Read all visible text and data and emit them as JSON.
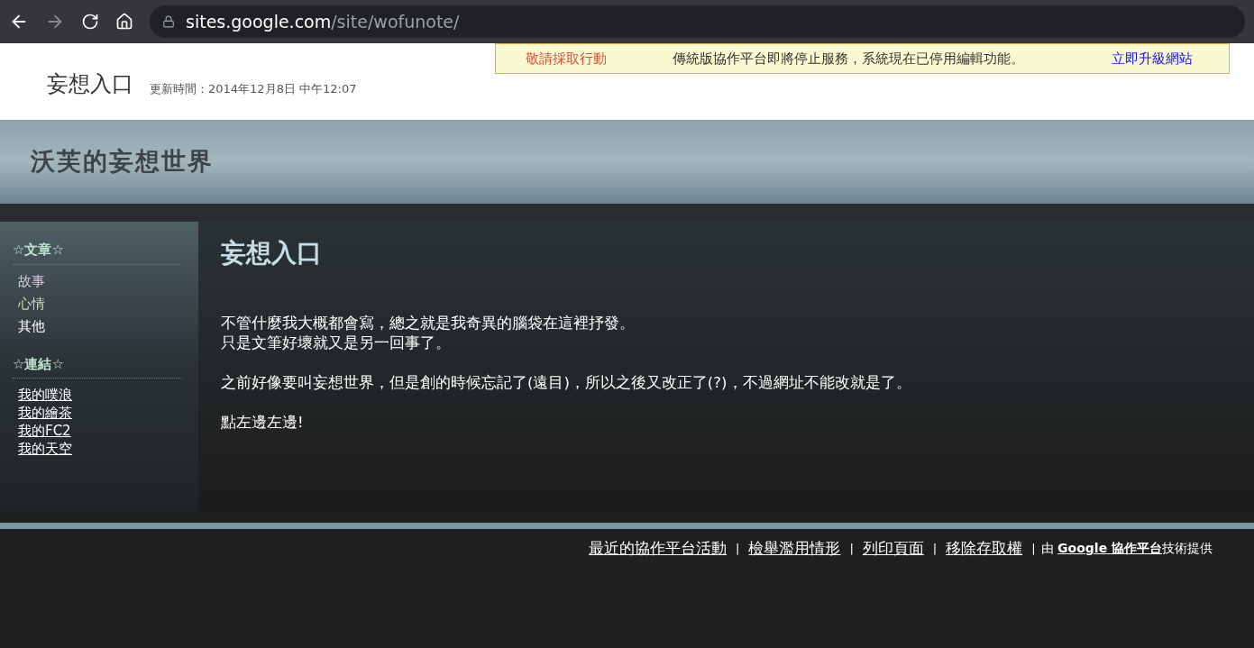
{
  "browser": {
    "url_host": "sites.google.com",
    "url_path": "/site/wofunote/"
  },
  "notice": {
    "action": "敬請採取行動",
    "message": "傳統版協作平台即將停止服務，系統現在已停用編輯功能。",
    "link": "立即升級網站"
  },
  "page_header": {
    "title": "妄想入口",
    "updated": "更新時間：2014年12月8日 中午12:07"
  },
  "site_title": "沃芙的妄想世界",
  "sidebar": {
    "sections": [
      {
        "heading": "☆文章☆",
        "kind": "nav",
        "items": [
          {
            "label": "故事",
            "color": "#d6c9e0"
          },
          {
            "label": "心情",
            "color": "#cfdcb4"
          },
          {
            "label": "其他",
            "color": "#ffffff"
          }
        ]
      },
      {
        "heading": "☆連結☆",
        "kind": "links",
        "items": [
          {
            "label": "我的噗浪",
            "color": "#ffffff"
          },
          {
            "label": "我的繪茶",
            "color": "#ffffff"
          },
          {
            "label": "我的FC2",
            "color": "#ffffff"
          },
          {
            "label": "我的天空",
            "color": "#ffffff"
          }
        ]
      }
    ]
  },
  "content": {
    "title": "妄想入口",
    "paragraphs": [
      [
        "不管什麼我大概都會寫，總之就是我奇異的腦袋在這裡抒發。",
        "只是文筆好壞就又是另一回事了。"
      ],
      [
        "之前好像要叫妄想世界，但是創的時候忘記了(遠目)，所以之後又改正了(?)，不過網址不能改就是了。"
      ],
      [
        "點左邊左邊!"
      ]
    ]
  },
  "footer": {
    "links": [
      "最近的協作平台活動",
      "檢舉濫用情形",
      "列印頁面",
      "移除存取權"
    ],
    "separator": "|",
    "credit_prefix": "由",
    "credit_link": "Google 協作平台",
    "credit_suffix": "技術提供"
  }
}
